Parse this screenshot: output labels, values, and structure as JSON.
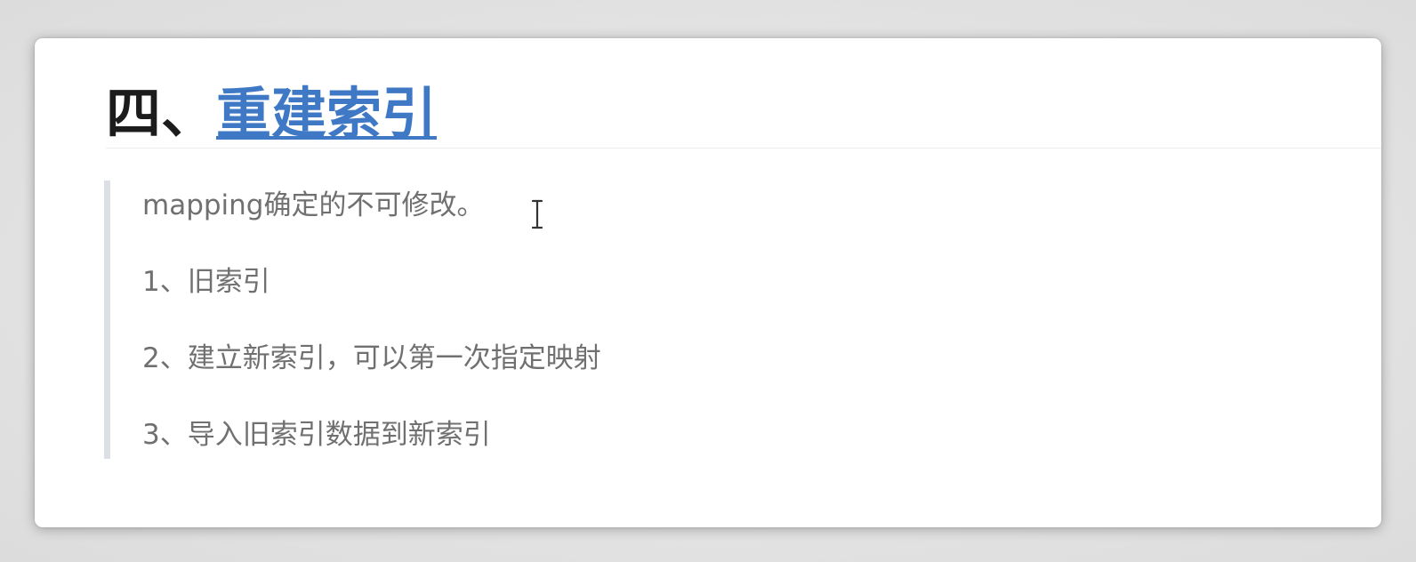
{
  "section": {
    "number": "四、",
    "title": "重建索引"
  },
  "quote": {
    "intro": "mapping确定的不可修改。",
    "steps": [
      "1、旧索引",
      "2、建立新索引，可以第一次指定映射",
      "3、导入旧索引数据到新索引"
    ]
  },
  "colors": {
    "link": "#3f78c4",
    "heading": "#1c1c1c",
    "body_text": "#707070",
    "quote_bar": "#dcdfe3"
  },
  "icons": {
    "cursor": "text-cursor-icon"
  }
}
